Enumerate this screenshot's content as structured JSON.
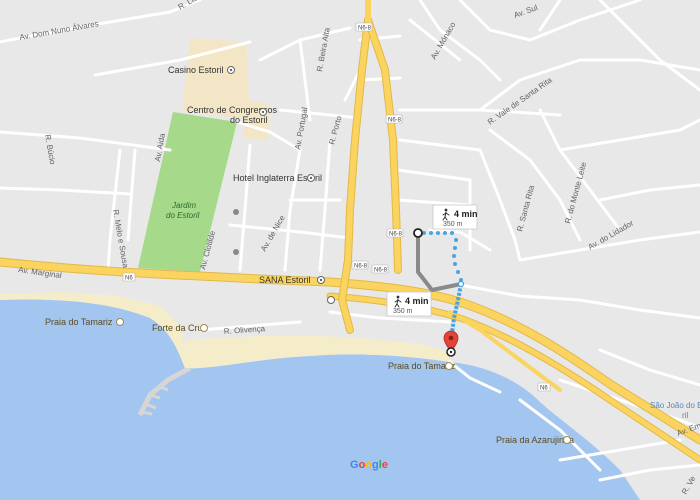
{
  "map": {
    "streets": {
      "dom_nuno": "Av. Dom Nuno Álvares",
      "r_lis": "R. Lis",
      "r_beira_alta": "R. Beira Alta",
      "av_portugal": "Av. Portugal",
      "r_porto": "R. Porto",
      "r_bucio": "R. Búcio",
      "av_aida": "Av. Aida",
      "r_melo_sousa": "R. Melo e Sousa",
      "av_clotilde": "Av. Clotilde",
      "av_nice": "Av. de Nice",
      "av_marginal": "Av. Marginal",
      "r_olivenca": "R. Olivença",
      "av_monaco": "Av. Mónaco",
      "av_sul": "Av. Sul",
      "r_vale_santa_rita": "R. Vale de Santa Rita",
      "r_santa_rita": "R. Santa Rita",
      "r_monte_leite": "R. do Monte Leite",
      "av_lidador": "Av. do Lidador",
      "av_em": "Av. Em",
      "r_ve": "R. Ve"
    },
    "shields": {
      "n6_8": "N6-8",
      "n6_8b": "N6-8",
      "n6_8c": "N6-8",
      "n6_8d": "N6-8",
      "n6_8e": "N6-8",
      "n6": "N6",
      "n6b": "N6"
    },
    "places": {
      "casino": "Casino Estoril",
      "centro_line1": "Centro de Congressos",
      "centro_line2": "do Estoril",
      "jardim_line1": "Jardim",
      "jardim_line2": "do Estoril",
      "hotel": "Hotel Inglaterra Estoril",
      "sana": "SANA Estoril",
      "praia_tamariz_w": "Praia do Tamariz",
      "forte": "Forte da Cruz",
      "praia_tamariz": "Praia do Tamariz",
      "praia_azarujinha": "Praia da Azarujinha",
      "sao_joao_line1": "São João do Esto",
      "sao_joao_line2": "ril"
    },
    "routes": {
      "walk": {
        "time": "4 min",
        "distance": "350 m"
      },
      "drive": {
        "time": "4 min",
        "distance": "350 m"
      }
    },
    "logo": [
      "G",
      "o",
      "o",
      "g",
      "l",
      "e"
    ],
    "icons": {
      "walk_icon": "walking-person-icon",
      "walk_icon_alt": "walking-person-icon",
      "origin": "origin-circle-icon",
      "destination": "destination-pin-icon"
    },
    "colors": {
      "water": "#a3c6f0",
      "park": "#a6d98a",
      "beach": "#f5edc9",
      "land": "#e8e8e8",
      "road_major": "#fad45e",
      "road_minor": "#ffffff",
      "route_walk": "#4aa3df",
      "route_drive": "#8a8a8a",
      "pin": "#e0453a"
    }
  }
}
